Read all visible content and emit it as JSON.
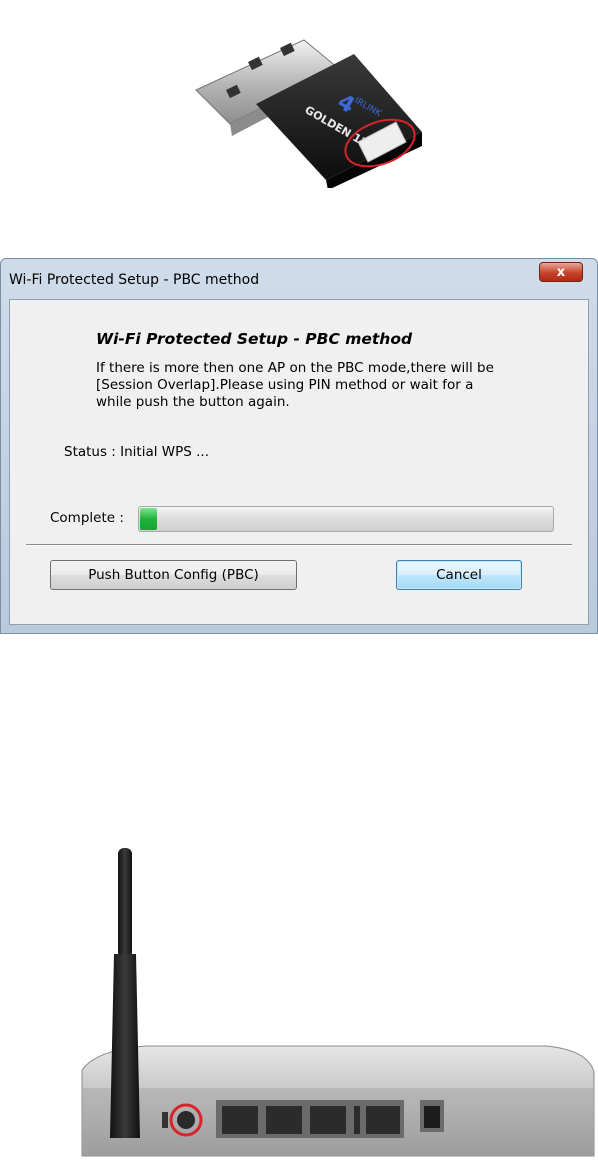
{
  "usb_adapter": {
    "brand_text": "AIRLINK 101",
    "model_text": "GOLDEN 150",
    "highlight_color": "#d9232d"
  },
  "dialog": {
    "title": "Wi-Fi Protected Setup - PBC method",
    "close_label": "x",
    "heading": "Wi-Fi Protected Setup - PBC method",
    "description": "If there is more then one AP on the PBC mode,there will be\n[Session Overlap].Please using PIN method or wait for a\nwhile push the button again.",
    "status": "Status : Initial WPS ...",
    "complete_label": "Complete :",
    "progress_percent": 4,
    "progress_color": "#1fb43a",
    "buttons": {
      "pbc": "Push Button Config (PBC)",
      "cancel": "Cancel"
    }
  },
  "router": {
    "highlight_color": "#d9232d"
  }
}
